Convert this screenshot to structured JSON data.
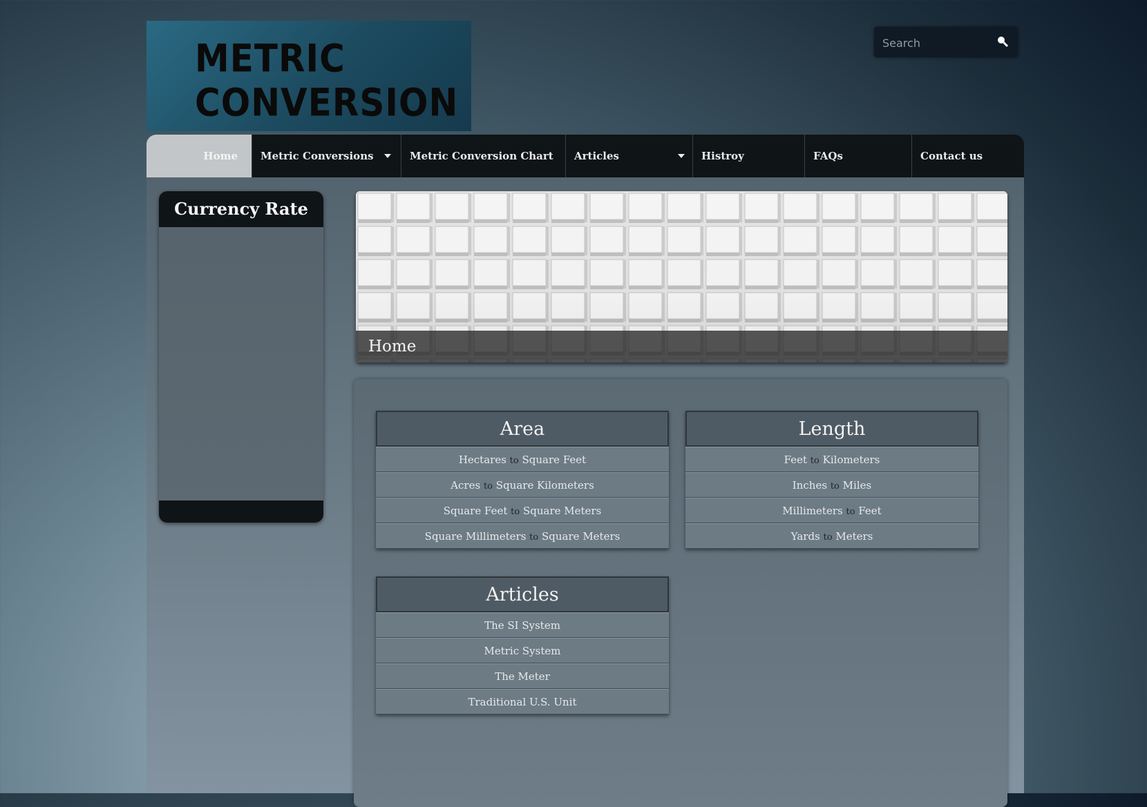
{
  "logo": {
    "line1": "METRIC",
    "line2": "CONVERSION"
  },
  "search": {
    "placeholder": "Search"
  },
  "nav": {
    "items": [
      {
        "label": "Home",
        "active": true
      },
      {
        "label": "Metric Conversions",
        "dropdown": true
      },
      {
        "label": "Metric Conversion Chart"
      },
      {
        "label": "Articles",
        "dropdown": true
      },
      {
        "label": "Histroy"
      },
      {
        "label": "FAQs"
      },
      {
        "label": "Contact us"
      }
    ]
  },
  "sidebar": {
    "currency_title": "Currency Rate"
  },
  "hero": {
    "caption": "Home"
  },
  "sections": {
    "area": {
      "title": "Area",
      "rows": [
        {
          "from": "Hectares",
          "to": "Square Feet"
        },
        {
          "from": "Acres",
          "to": "Square Kilometers"
        },
        {
          "from": "Square Feet",
          "to": "Square Meters"
        },
        {
          "from": "Square Millimeters",
          "to": "Square Meters"
        }
      ]
    },
    "length": {
      "title": "Length",
      "rows": [
        {
          "from": "Feet",
          "to": "Kilometers"
        },
        {
          "from": "Inches",
          "to": "Miles"
        },
        {
          "from": "Millimeters",
          "to": "Feet"
        },
        {
          "from": "Yards",
          "to": "Meters"
        }
      ]
    },
    "articles": {
      "title": "Articles",
      "rows": [
        "The SI System",
        "Metric System",
        "The Meter",
        "Traditional U.S. Unit"
      ]
    }
  },
  "connector": "to"
}
